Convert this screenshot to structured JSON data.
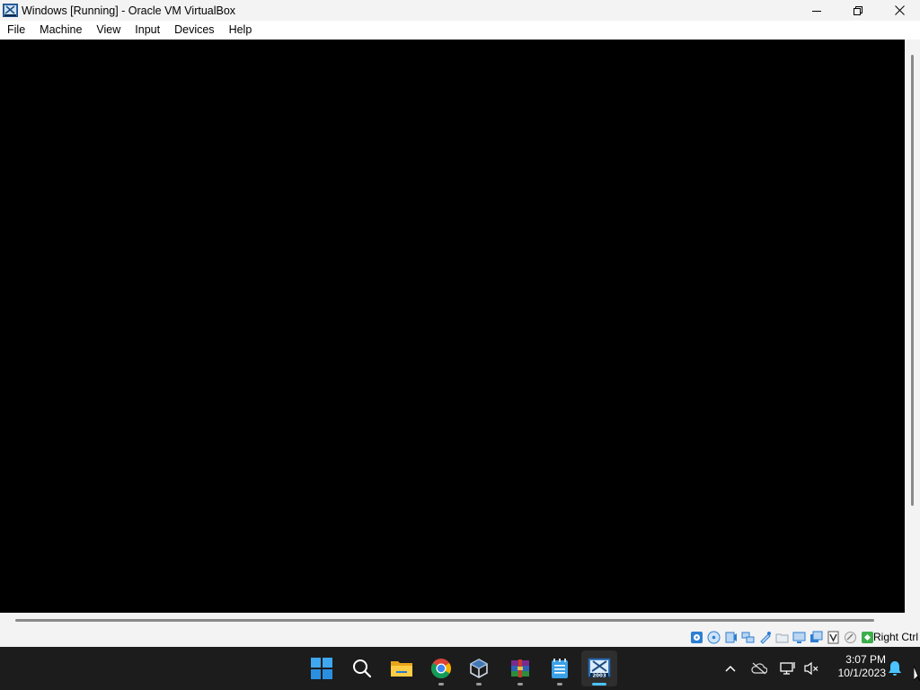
{
  "window": {
    "title": "Windows [Running] - Oracle VM VirtualBox"
  },
  "menu": {
    "items": [
      "File",
      "Machine",
      "View",
      "Input",
      "Devices",
      "Help"
    ]
  },
  "statusbar": {
    "icons": [
      "hard-disk-icon",
      "optical-drive-icon",
      "audio-icon",
      "network-icon",
      "usb-icon",
      "shared-folders-icon",
      "display-icon",
      "video-capture-icon",
      "virtualization-icon",
      "mouse-integration-icon",
      "keyboard-capture-icon"
    ],
    "host_key": "Right Ctrl"
  },
  "taskbar": {
    "apps": [
      {
        "name": "start-button",
        "icon": "windows-logo-icon",
        "running": false
      },
      {
        "name": "search-button",
        "icon": "search-icon",
        "running": false
      },
      {
        "name": "file-explorer-button",
        "icon": "folder-icon",
        "running": false
      },
      {
        "name": "chrome-button",
        "icon": "chrome-icon",
        "running": true
      },
      {
        "name": "virtualbox-button",
        "icon": "virtualbox-icon",
        "running": true
      },
      {
        "name": "winrar-button",
        "icon": "winrar-icon",
        "running": true
      },
      {
        "name": "notepad-button",
        "icon": "notepad-icon",
        "running": true
      },
      {
        "name": "vm-window-button",
        "icon": "windows-2003-vm-icon",
        "running": true,
        "active": true
      }
    ],
    "vm_icon_label": "2003"
  },
  "tray": {
    "icons": [
      "chevron-up-icon",
      "onedrive-icon",
      "network-icon",
      "volume-muted-icon"
    ],
    "time": "3:07 PM",
    "date": "10/1/2023"
  },
  "colors": {
    "taskbar_bg": "#1c1c1c",
    "active_indicator": "#4cc2ff",
    "vm_screen": "#000000"
  }
}
